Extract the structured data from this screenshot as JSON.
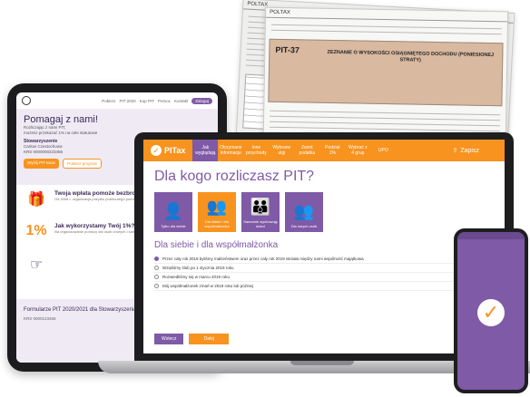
{
  "colors": {
    "accent": "#f7931e",
    "brand": "#7f5aa6"
  },
  "forms": {
    "back_header": "POLTAX",
    "front_code": "PIT-37",
    "front_title": "ZEZNANIE O WYSOKOŚCI OSIĄGNIĘTEGO DOCHODU (PONIESIONEJ STRATY)"
  },
  "tablet": {
    "nav_items": [
      "Pobierz",
      "PIT 2020",
      "Kup PIT",
      "Pomoc",
      "Kontakt"
    ],
    "nav_cta": "Zaloguj",
    "hero_title": "Pomagaj z nami!",
    "hero_line1": "Rozliczając z nami PIT,",
    "hero_line2": "możesz przekazać 1% na cele statutowe",
    "org_label": "Stowarzyszenie",
    "org_name": "Caritas Czestochowa",
    "krs": "KRS 0000000223456",
    "btn_primary": "Wyślij PIT teraz",
    "btn_secondary": "Pobierz program",
    "sec1_title": "Twoja wpłata pomoże bezbronnym.",
    "sec1_text": "Od 2008 r. organizacja pożytku publicznego pomaga potrzebującym w Częstochowie",
    "sec2_title": "Jak wykorzystamy Twój 1%?",
    "sec2_text": "Na organizowanie pomocy dla osób chorych i samotnych",
    "footer_title": "Formularze PIT 2020/2021 dla Stowarzyszenia",
    "footer_krs": "KRS 0000123456"
  },
  "laptop": {
    "logo": "PITax",
    "nav": [
      "Jak wyglądają",
      "Otrzymane informacje",
      "Inne przychody",
      "Wybrane ulgi",
      "Zwrot podatku",
      "Podział 1%",
      "Wybrać z 4 grup",
      "UPO"
    ],
    "save": "Zapisz",
    "title": "Dla kogo rozliczasz PIT?",
    "tiles": [
      "Tylko dla siebie",
      "Dla siebie i dla współmałżonka",
      "Samotnie wychowuję dzieci",
      "Dla innych osób"
    ],
    "subtitle": "Dla siebie i dla współmałżonka",
    "options": [
      "Przez cały rok 2019 byliśmy małżeństwem oraz przez cały rok 2019 istniała między nami wspólność majątkowa",
      "Wzięliśmy ślub po 1 stycznia 2019 roku",
      "Rozwiedliśmy się w marcu 2019 roku",
      "Mój współmałżonek zmarł w 2019 roku lub później"
    ],
    "back": "Wstecz",
    "next": "Dalej"
  }
}
